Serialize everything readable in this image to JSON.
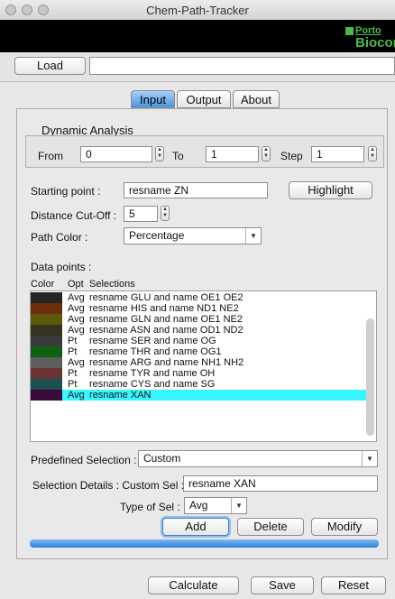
{
  "window": {
    "title": "Chem-Path-Tracker"
  },
  "banner": {
    "logo_line1": "Porto",
    "logo_line2": "Biocomp"
  },
  "toolbar": {
    "load_label": "Load",
    "path_value": ""
  },
  "tabs": [
    {
      "label": "Input",
      "active": true
    },
    {
      "label": "Output",
      "active": false
    },
    {
      "label": "About",
      "active": false
    }
  ],
  "dynamic": {
    "title": "Dynamic Analysis",
    "from_label": "From",
    "from_value": "0",
    "to_label": "To",
    "to_value": "1",
    "step_label": "Step",
    "step_value": "1"
  },
  "starting": {
    "label": "Starting point :",
    "value": "resname ZN",
    "highlight_label": "Highlight"
  },
  "cutoff": {
    "label": "Distance Cut-Off :",
    "value": "5"
  },
  "path_color": {
    "label": "Path Color :",
    "value": "Percentage"
  },
  "data_points": {
    "label": "Data points :",
    "headers": {
      "color": "Color",
      "opt": "Opt",
      "selections": "Selections"
    },
    "rows": [
      {
        "color": "#262626",
        "opt": "Avg",
        "sel": "resname GLU and name OE1 OE2"
      },
      {
        "color": "#6e2e0c",
        "opt": "Avg",
        "sel": "resname HIS and name ND1 NE2"
      },
      {
        "color": "#5c5a0a",
        "opt": "Avg",
        "sel": "resname GLN and name OE1 NE2"
      },
      {
        "color": "#33331e",
        "opt": "Avg",
        "sel": "resname ASN and name OD1 ND2"
      },
      {
        "color": "#3a3a3a",
        "opt": "Pt",
        "sel": "resname SER and name OG"
      },
      {
        "color": "#0f6010",
        "opt": "Pt",
        "sel": "resname THR and name OG1"
      },
      {
        "color": "#5e5e5e",
        "opt": "Avg",
        "sel": "resname ARG and name NH1 NH2"
      },
      {
        "color": "#6a3434",
        "opt": "Pt",
        "sel": "resname TYR and name OH"
      },
      {
        "color": "#1c5050",
        "opt": "Pt",
        "sel": "resname CYS and name SG"
      },
      {
        "color": "#3a0a3a",
        "opt": "Avg",
        "sel": "resname XAN"
      }
    ],
    "highlight_color": "#36f6ff"
  },
  "predefined": {
    "label": "Predefined Selection :",
    "value": "Custom"
  },
  "details": {
    "label": "Selection Details : Custom Sel :",
    "value": "resname XAN"
  },
  "typesel": {
    "label": "Type of Sel :",
    "value": "Avg"
  },
  "actions": {
    "add": "Add",
    "delete": "Delete",
    "modify": "Modify"
  },
  "footer": {
    "calculate": "Calculate",
    "save": "Save",
    "reset": "Reset"
  },
  "colors": {
    "accent": "#4a93e4",
    "logo_green": "#4db84a"
  }
}
